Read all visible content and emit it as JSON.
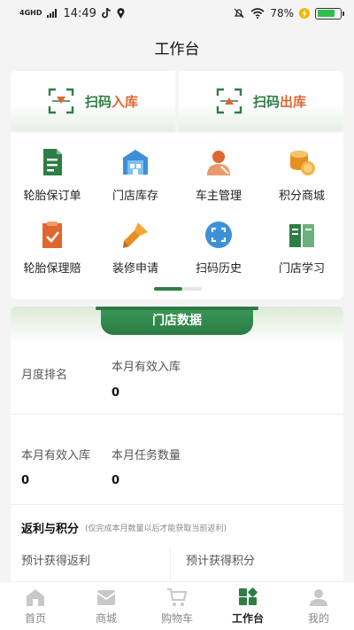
{
  "status_bar": {
    "network": "4GHD",
    "time": "14:49",
    "battery_percent": "78%",
    "battery_level": 0.78
  },
  "page": {
    "title": "工作台"
  },
  "scan": {
    "in": {
      "prefix": "扫码",
      "accent": "入库"
    },
    "out": {
      "prefix": "扫码",
      "accent": "出库"
    }
  },
  "grid": {
    "items": [
      {
        "label": "轮胎保订单",
        "icon": "document-icon"
      },
      {
        "label": "门店库存",
        "icon": "warehouse-icon"
      },
      {
        "label": "车主管理",
        "icon": "user-icon"
      },
      {
        "label": "积分商城",
        "icon": "coins-icon"
      },
      {
        "label": "轮胎保理赔",
        "icon": "claim-icon"
      },
      {
        "label": "装修申请",
        "icon": "brush-icon"
      },
      {
        "label": "扫码历史",
        "icon": "scan-history-icon"
      },
      {
        "label": "门店学习",
        "icon": "book-icon"
      }
    ]
  },
  "store": {
    "title": "门店数据",
    "monthly_rank_label": "月度排名",
    "valid_in_label": "本月有效入库",
    "valid_in_value": "0",
    "valid_in_label_2": "本月有效入库",
    "valid_in_value_2": "0",
    "task_label": "本月任务数量",
    "task_value": "0",
    "rebate_title": "返利与积分",
    "rebate_note": "(仅完成本月数量以后才能获取当前返利)",
    "expected_rebate_label": "预计获得返利",
    "expected_points_label": "预计获得积分"
  },
  "tabbar": {
    "tabs": [
      {
        "label": "首页",
        "icon": "home-icon"
      },
      {
        "label": "商城",
        "icon": "mail-icon"
      },
      {
        "label": "购物车",
        "icon": "cart-icon"
      },
      {
        "label": "工作台",
        "icon": "workbench-icon",
        "active": true
      },
      {
        "label": "我的",
        "icon": "profile-icon"
      }
    ]
  },
  "colors": {
    "brand": "#2f7d46",
    "accent": "#e0662f"
  }
}
